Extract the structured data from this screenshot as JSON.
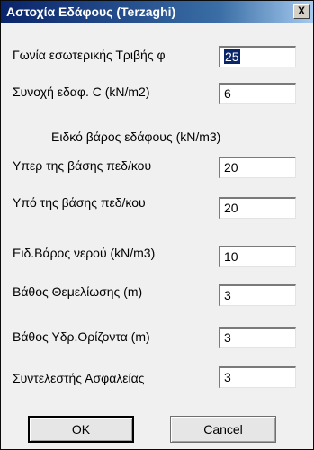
{
  "window": {
    "title": "Αστοχία Εδάφους (Terzaghi)",
    "close_glyph": "X"
  },
  "fields": {
    "friction_angle": {
      "label": "Γωνία εσωτερικής Τριβής φ",
      "value": "25"
    },
    "cohesion": {
      "label": "Συνοχή εδαφ. C (kN/m2)",
      "value": "6"
    },
    "unit_weight_title": "Ειδκό βάρος εδάφους (kN/m3)",
    "above_base": {
      "label": "Υπερ της βάσης πεδ/κου",
      "value": "20"
    },
    "below_base": {
      "label": "Υπό της βάσης πεδ/κου",
      "value": "20"
    },
    "water_unit_weight": {
      "label": "Ειδ.Βάρος νερού (kN/m3)",
      "value": "10"
    },
    "foundation_depth": {
      "label": "Βάθος Θεμελίωσης (m)",
      "value": "3"
    },
    "water_table_depth": {
      "label": "Βάθος Υδρ.Ορίζοντα (m)",
      "value": "3"
    },
    "safety_factor": {
      "label": "Συντελεστής Ασφαλείας",
      "value": "3"
    }
  },
  "buttons": {
    "ok": "OK",
    "cancel": "Cancel"
  }
}
